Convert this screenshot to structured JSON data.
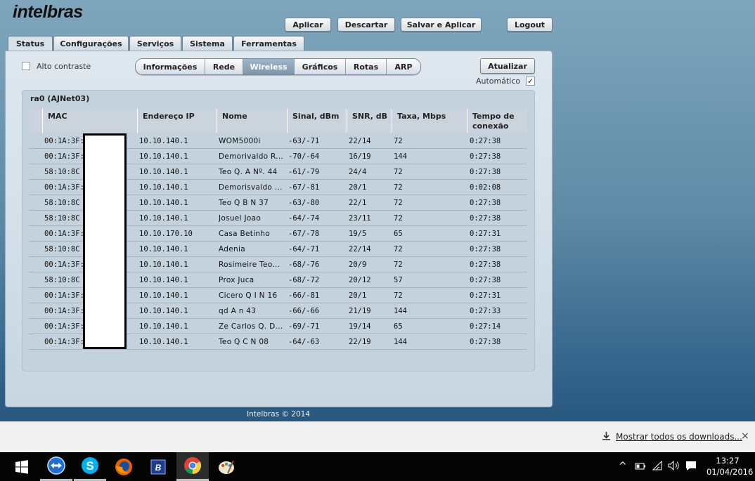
{
  "brand": "intelbras",
  "toolbar": {
    "apply": "Aplicar",
    "discard": "Descartar",
    "save_apply": "Salvar e Aplicar",
    "logout": "Logout"
  },
  "tabs": [
    "Status",
    "Configurações",
    "Serviços",
    "Sistema",
    "Ferramentas"
  ],
  "high_contrast": "Alto contraste",
  "subtabs": [
    "Informações",
    "Rede",
    "Wireless",
    "Gráficos",
    "Rotas",
    "ARP"
  ],
  "update_button": "Atualizar",
  "automatic_label": "Automático",
  "section_title": "ra0 (AJNet03)",
  "columns": [
    "MAC",
    "Endereço IP",
    "Nome",
    "Sinal, dBm",
    "SNR, dB",
    "Taxa, Mbps",
    "Tempo de conexão"
  ],
  "rows": [
    [
      "00:1A:3F:",
      "10.10.140.1",
      "WOM5000i",
      "-63/-71",
      "22/14",
      "72",
      "0:27:38"
    ],
    [
      "00:1A:3F:",
      "10.10.140.1",
      "Demorivaldo R...",
      "-70/-64",
      "16/19",
      "144",
      "0:27:38"
    ],
    [
      "58:10:8C",
      "10.10.140.1",
      "Teo Q. A Nº. 44",
      "-61/-79",
      "24/4",
      "72",
      "0:27:38"
    ],
    [
      "00:1A:3F:",
      "10.10.140.1",
      "Demorisvaldo ...",
      "-67/-81",
      "20/1",
      "72",
      "0:02:08"
    ],
    [
      "58:10:8C",
      "10.10.140.1",
      "Teo Q B N 37",
      "-63/-80",
      "22/1",
      "72",
      "0:27:38"
    ],
    [
      "58:10:8C",
      "10.10.140.1",
      "Josuel Joao",
      "-64/-74",
      "23/11",
      "72",
      "0:27:38"
    ],
    [
      "00:1A:3F:",
      "10.10.170.10",
      "Casa Betinho",
      "-67/-78",
      "19/5",
      "65",
      "0:27:31"
    ],
    [
      "58:10:8C",
      "10.10.140.1",
      "Adenia",
      "-64/-71",
      "22/14",
      "72",
      "0:27:38"
    ],
    [
      "00:1A:3F:",
      "10.10.140.1",
      "Rosimeire Teo...",
      "-68/-76",
      "20/9",
      "72",
      "0:27:38"
    ],
    [
      "58:10:8C",
      "10.10.140.1",
      "Prox Juca",
      "-68/-72",
      "20/12",
      "57",
      "0:27:38"
    ],
    [
      "00:1A:3F:",
      "10.10.140.1",
      "Cicero Q I N 16",
      "-66/-81",
      "20/1",
      "72",
      "0:27:31"
    ],
    [
      "00:1A:3F:",
      "10.10.140.1",
      "qd A n 43",
      "-66/-66",
      "21/19",
      "144",
      "0:27:33"
    ],
    [
      "00:1A:3F:",
      "10.10.140.1",
      "Ze Carlos Q. D...",
      "-69/-71",
      "19/14",
      "65",
      "0:27:14"
    ],
    [
      "00:1A:3F:",
      "10.10.140.1",
      "Teo Q C N 08",
      "-64/-63",
      "22/19",
      "144",
      "0:27:38"
    ]
  ],
  "footer": "Intelbras © 2014",
  "downloads": {
    "show_all": "Mostrar todos os downloads...",
    "close": "×"
  },
  "taskbar": {
    "time": "13:27",
    "date": "01/04/2016",
    "icons": [
      "windows-start-icon",
      "teamviewer-icon",
      "skype-icon",
      "firefox-icon",
      "winbox-icon",
      "chrome-icon",
      "paint-icon"
    ]
  },
  "colors": {
    "accent_tab": "#7d97ab",
    "panel": "#dfe8ef",
    "table_bg": "#c3d2dd"
  }
}
